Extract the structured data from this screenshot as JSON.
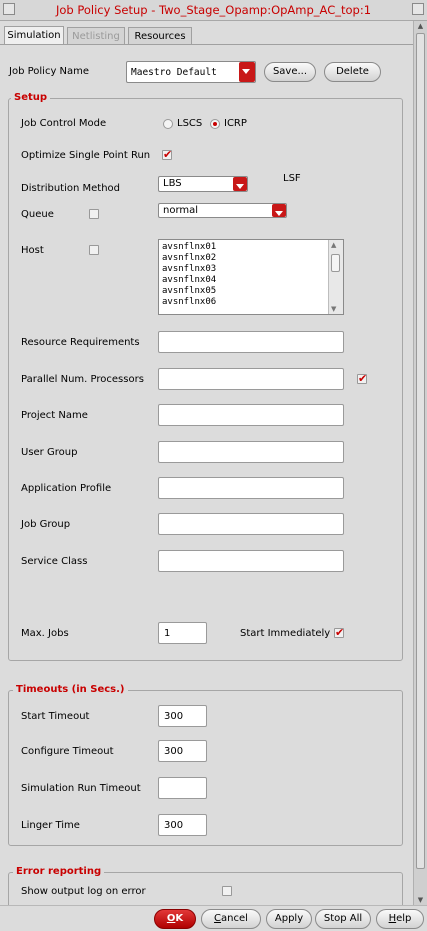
{
  "window": {
    "title": "Job Policy Setup - Two_Stage_Opamp:OpAmp_AC_top:1"
  },
  "tabs": [
    {
      "label": "Simulation",
      "state": "active"
    },
    {
      "label": "Netlisting",
      "state": "disabled"
    },
    {
      "label": "Resources",
      "state": "normal"
    }
  ],
  "policy": {
    "label": "Job Policy Name",
    "value": "Maestro Default",
    "save_label": "Save...",
    "delete_label": "Delete"
  },
  "setup": {
    "title": "Setup",
    "job_control_mode": {
      "label": "Job Control Mode",
      "options": [
        "LSCS",
        "ICRP"
      ],
      "selected": "ICRP"
    },
    "optimize": {
      "label": "Optimize Single Point Run",
      "checked": true
    },
    "distribution": {
      "label": "Distribution Method",
      "value": "LBS",
      "note": "LSF"
    },
    "queue": {
      "label": "Queue",
      "checked": false,
      "value": "normal"
    },
    "host": {
      "label": "Host",
      "checked": false,
      "items": [
        "avsnflnx01",
        "avsnflnx02",
        "avsnflnx03",
        "avsnflnx04",
        "avsnflnx05",
        "avsnflnx06"
      ]
    },
    "fields": {
      "resource_requirements": {
        "label": "Resource Requirements",
        "value": ""
      },
      "parallel_processors": {
        "label": "Parallel Num. Processors",
        "value": "",
        "checked": true
      },
      "project_name": {
        "label": "Project Name",
        "value": ""
      },
      "user_group": {
        "label": "User Group",
        "value": ""
      },
      "application_profile": {
        "label": "Application Profile",
        "value": ""
      },
      "job_group": {
        "label": "Job Group",
        "value": ""
      },
      "service_class": {
        "label": "Service Class",
        "value": ""
      }
    },
    "max_jobs": {
      "label": "Max. Jobs",
      "value": "1"
    },
    "start_immediately": {
      "label": "Start Immediately",
      "checked": true
    }
  },
  "timeouts": {
    "title": "Timeouts (in Secs.)",
    "start": {
      "label": "Start Timeout",
      "value": "300"
    },
    "configure": {
      "label": "Configure Timeout",
      "value": "300"
    },
    "simulation_run": {
      "label": "Simulation Run Timeout",
      "value": ""
    },
    "linger": {
      "label": "Linger Time",
      "value": "300"
    }
  },
  "error_reporting": {
    "title": "Error reporting",
    "show_log": {
      "label": "Show output log on error",
      "checked": false
    }
  },
  "buttons": {
    "ok": {
      "label": "OK",
      "mnemonic": "O",
      "rest": "K"
    },
    "cancel": {
      "label": "Cancel",
      "mnemonic": "C",
      "rest": "ancel"
    },
    "apply": {
      "label": "Apply"
    },
    "stop_all": {
      "label": "Stop All"
    },
    "help": {
      "label": "Help",
      "mnemonic": "H",
      "rest": "elp"
    }
  },
  "colors": {
    "accent": "#c80000",
    "background": "#dcdcdc",
    "ok_button": "#c81818"
  },
  "icons": {
    "checked": "check-mark-icon",
    "dropdown": "chevron-down-icon"
  }
}
